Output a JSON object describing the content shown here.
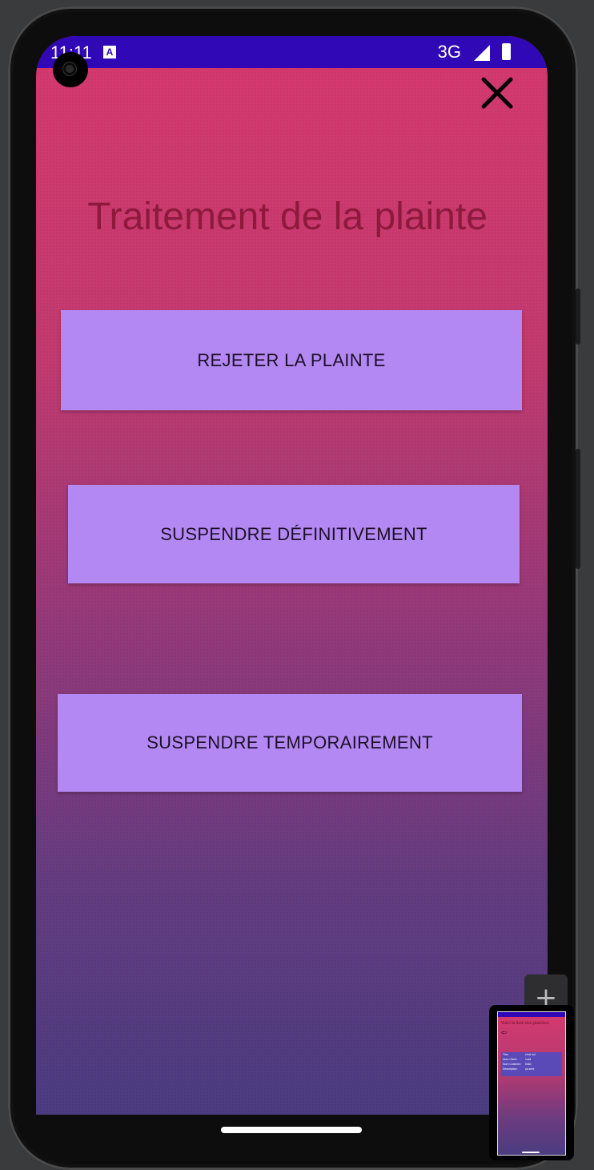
{
  "status_bar": {
    "time": "11:11",
    "notification_icon": "a-notification-icon",
    "network": "3G"
  },
  "toolbar": {
    "close_icon": "close-icon"
  },
  "page": {
    "title": "Traitement de la plainte"
  },
  "actions": {
    "reject_label": "REJETER LA PLAINTE",
    "suspend_permanent_label": "SUSPENDRE DÉFINITIVEMENT",
    "suspend_temporary_label": "SUSPENDRE TEMPORAIREMENT"
  },
  "emulator": {
    "zoom_label": "+",
    "preview": {
      "title": "Voici la liste des plaintes:",
      "arrow": "⇦",
      "rows": [
        {
          "label": "Titre",
          "value": "c'est nul"
        },
        {
          "label": "Nom Client:",
          "value": "voidi"
        },
        {
          "label": "Nom Cuisinier:",
          "value": "hidid"
        },
        {
          "label": "Description:",
          "value": "ça sent"
        }
      ]
    }
  },
  "colors": {
    "status_bar": "#3108b6",
    "gradient_top": "#d6396e",
    "gradient_bottom": "#4b3c80",
    "button_bg": "#b388f2",
    "title_color": "#8d1a3c"
  }
}
